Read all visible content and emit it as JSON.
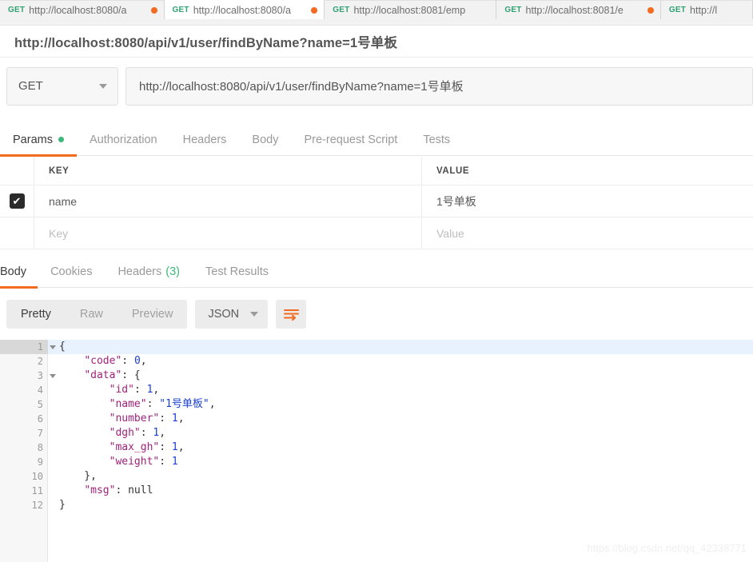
{
  "tabbar": {
    "tabs": [
      {
        "method": "GET",
        "url": "http://localhost:8080/a",
        "dirty": true,
        "active": false
      },
      {
        "method": "GET",
        "url": "http://localhost:8080/a",
        "dirty": true,
        "active": true
      },
      {
        "method": "GET",
        "url": "http://localhost:8081/emp",
        "dirty": false,
        "active": false
      },
      {
        "method": "GET",
        "url": "http://localhost:8081/e",
        "dirty": true,
        "active": false
      },
      {
        "method": "GET",
        "url": "http://l",
        "dirty": false,
        "active": false
      }
    ]
  },
  "request": {
    "title": "http://localhost:8080/api/v1/user/findByName?name=1号单板",
    "method": "GET",
    "url": "http://localhost:8080/api/v1/user/findByName?name=1号单板",
    "tabs": [
      {
        "label": "Params",
        "active": true,
        "dot": true
      },
      {
        "label": "Authorization",
        "active": false,
        "dot": false
      },
      {
        "label": "Headers",
        "active": false,
        "dot": false
      },
      {
        "label": "Body",
        "active": false,
        "dot": false
      },
      {
        "label": "Pre-request Script",
        "active": false,
        "dot": false
      },
      {
        "label": "Tests",
        "active": false,
        "dot": false
      }
    ],
    "params": {
      "headers": {
        "key": "KEY",
        "value": "VALUE"
      },
      "rows": [
        {
          "checked": true,
          "key": "name",
          "value": "1号单板",
          "placeholder": false
        },
        {
          "checked": false,
          "key": "Key",
          "value": "Value",
          "placeholder": true
        }
      ]
    }
  },
  "response": {
    "tabs": [
      {
        "label": "Body",
        "active": true,
        "count": ""
      },
      {
        "label": "Cookies",
        "active": false,
        "count": ""
      },
      {
        "label": "Headers",
        "active": false,
        "count": "(3)"
      },
      {
        "label": "Test Results",
        "active": false,
        "count": ""
      }
    ],
    "view_modes": [
      {
        "label": "Pretty",
        "active": true
      },
      {
        "label": "Raw",
        "active": false
      },
      {
        "label": "Preview",
        "active": false
      }
    ],
    "format": "JSON",
    "wrap_icon": "word-wrap-icon",
    "accent_color": "#f26b21",
    "body_lines": [
      {
        "num": "1",
        "fold": true,
        "highlight": true,
        "tokens": [
          {
            "t": "p",
            "v": "{"
          }
        ]
      },
      {
        "num": "2",
        "fold": false,
        "highlight": false,
        "tokens": [
          {
            "t": "p",
            "v": "    "
          },
          {
            "t": "k",
            "v": "\"code\""
          },
          {
            "t": "p",
            "v": ": "
          },
          {
            "t": "n",
            "v": "0"
          },
          {
            "t": "p",
            "v": ","
          }
        ]
      },
      {
        "num": "3",
        "fold": true,
        "highlight": false,
        "tokens": [
          {
            "t": "p",
            "v": "    "
          },
          {
            "t": "k",
            "v": "\"data\""
          },
          {
            "t": "p",
            "v": ": {"
          }
        ]
      },
      {
        "num": "4",
        "fold": false,
        "highlight": false,
        "tokens": [
          {
            "t": "p",
            "v": "        "
          },
          {
            "t": "k",
            "v": "\"id\""
          },
          {
            "t": "p",
            "v": ": "
          },
          {
            "t": "n",
            "v": "1"
          },
          {
            "t": "p",
            "v": ","
          }
        ]
      },
      {
        "num": "5",
        "fold": false,
        "highlight": false,
        "tokens": [
          {
            "t": "p",
            "v": "        "
          },
          {
            "t": "k",
            "v": "\"name\""
          },
          {
            "t": "p",
            "v": ": "
          },
          {
            "t": "s",
            "v": "\"1号单板\""
          },
          {
            "t": "p",
            "v": ","
          }
        ]
      },
      {
        "num": "6",
        "fold": false,
        "highlight": false,
        "tokens": [
          {
            "t": "p",
            "v": "        "
          },
          {
            "t": "k",
            "v": "\"number\""
          },
          {
            "t": "p",
            "v": ": "
          },
          {
            "t": "n",
            "v": "1"
          },
          {
            "t": "p",
            "v": ","
          }
        ]
      },
      {
        "num": "7",
        "fold": false,
        "highlight": false,
        "tokens": [
          {
            "t": "p",
            "v": "        "
          },
          {
            "t": "k",
            "v": "\"dgh\""
          },
          {
            "t": "p",
            "v": ": "
          },
          {
            "t": "n",
            "v": "1"
          },
          {
            "t": "p",
            "v": ","
          }
        ]
      },
      {
        "num": "8",
        "fold": false,
        "highlight": false,
        "tokens": [
          {
            "t": "p",
            "v": "        "
          },
          {
            "t": "k",
            "v": "\"max_gh\""
          },
          {
            "t": "p",
            "v": ": "
          },
          {
            "t": "n",
            "v": "1"
          },
          {
            "t": "p",
            "v": ","
          }
        ]
      },
      {
        "num": "9",
        "fold": false,
        "highlight": false,
        "tokens": [
          {
            "t": "p",
            "v": "        "
          },
          {
            "t": "k",
            "v": "\"weight\""
          },
          {
            "t": "p",
            "v": ": "
          },
          {
            "t": "n",
            "v": "1"
          }
        ]
      },
      {
        "num": "10",
        "fold": false,
        "highlight": false,
        "tokens": [
          {
            "t": "p",
            "v": "    },"
          }
        ]
      },
      {
        "num": "11",
        "fold": false,
        "highlight": false,
        "tokens": [
          {
            "t": "p",
            "v": "    "
          },
          {
            "t": "k",
            "v": "\"msg\""
          },
          {
            "t": "p",
            "v": ": null"
          }
        ]
      },
      {
        "num": "12",
        "fold": false,
        "highlight": false,
        "tokens": [
          {
            "t": "p",
            "v": "}"
          }
        ]
      }
    ]
  },
  "watermark": "https://blog.csdn.net/qq_42338771"
}
